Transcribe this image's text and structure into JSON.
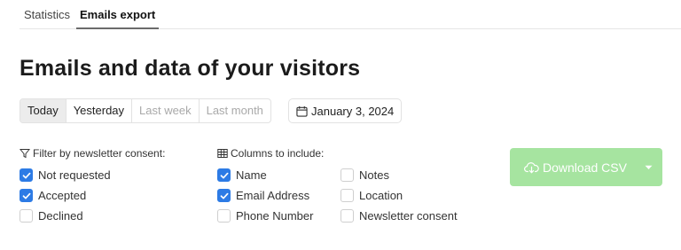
{
  "tabs": [
    {
      "label": "Statistics",
      "active": false
    },
    {
      "label": "Emails export",
      "active": true
    }
  ],
  "page_title": "Emails and data of your visitors",
  "date_range": {
    "options": [
      "Today",
      "Yesterday",
      "Last week",
      "Last month"
    ],
    "selected": "Today",
    "disabled": [
      "Last week",
      "Last month"
    ]
  },
  "date_picker": {
    "value": "January 3, 2024",
    "icon": "calendar-icon"
  },
  "filter": {
    "heading": "Filter by newsletter consent:",
    "icon": "filter-icon",
    "options": [
      {
        "label": "Not requested",
        "checked": true
      },
      {
        "label": "Accepted",
        "checked": true
      },
      {
        "label": "Declined",
        "checked": false
      }
    ]
  },
  "columns": {
    "heading": "Columns to include:",
    "icon": "table-icon",
    "options": [
      {
        "label": "Name",
        "checked": true
      },
      {
        "label": "Email Address",
        "checked": true
      },
      {
        "label": "Phone Number",
        "checked": false
      },
      {
        "label": "Notes",
        "checked": false
      },
      {
        "label": "Location",
        "checked": false
      },
      {
        "label": "Newsletter consent",
        "checked": false
      }
    ]
  },
  "download": {
    "label": "Download CSV",
    "icon": "cloud-download-icon",
    "menu_icon": "caret-down-icon",
    "disabled": true
  },
  "colors": {
    "accent": "#2d7be5",
    "download_bg": "#a6e4a0",
    "muted_text": "#a9a9a9"
  }
}
